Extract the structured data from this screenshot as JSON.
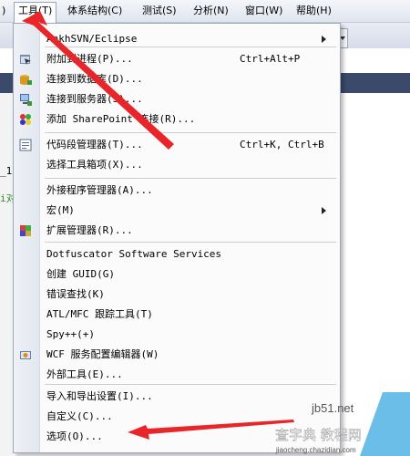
{
  "menubar": {
    "edge_label": ")",
    "items": [
      {
        "name": "menu-tools",
        "label": "工具(T)"
      },
      {
        "name": "menu-architecture",
        "label": "体系结构(C)"
      },
      {
        "name": "menu-test",
        "label": "测试(S)"
      },
      {
        "name": "menu-analyze",
        "label": "分析(N)"
      },
      {
        "name": "menu-window",
        "label": "窗口(W)"
      },
      {
        "name": "menu-help",
        "label": "帮助(H)"
      }
    ]
  },
  "background": {
    "fragment_underscore": "_1",
    "fragment_green": "i对"
  },
  "tools_menu": {
    "items": [
      {
        "label": "AnkhSVN/Eclipse",
        "shortcut": "",
        "submenu": true,
        "icon": ""
      },
      {
        "label": "附加到进程(P)...",
        "shortcut": "Ctrl+Alt+P",
        "submenu": false,
        "icon": "attach-process-icon"
      },
      {
        "label": "连接到数据库(D)...",
        "shortcut": "",
        "submenu": false,
        "icon": "connect-database-icon"
      },
      {
        "label": "连接到服务器(S)...",
        "shortcut": "",
        "submenu": false,
        "icon": "connect-server-icon"
      },
      {
        "label": "添加 SharePoint 连接(R)...",
        "shortcut": "",
        "submenu": false,
        "icon": "sharepoint-icon"
      },
      {
        "label": "代码段管理器(T)...",
        "shortcut": "Ctrl+K, Ctrl+B",
        "submenu": false,
        "icon": "code-snippets-icon"
      },
      {
        "label": "选择工具箱项(X)...",
        "shortcut": "",
        "submenu": false,
        "icon": ""
      },
      {
        "label": "外接程序管理器(A)...",
        "shortcut": "",
        "submenu": false,
        "icon": ""
      },
      {
        "label": "宏(M)",
        "shortcut": "",
        "submenu": true,
        "icon": ""
      },
      {
        "label": "扩展管理器(R)...",
        "shortcut": "",
        "submenu": false,
        "icon": "extension-manager-icon"
      },
      {
        "label": "Dotfuscator Software Services",
        "shortcut": "",
        "submenu": false,
        "icon": ""
      },
      {
        "label": "创建 GUID(G)",
        "shortcut": "",
        "submenu": false,
        "icon": ""
      },
      {
        "label": "错误查找(K)",
        "shortcut": "",
        "submenu": false,
        "icon": ""
      },
      {
        "label": "ATL/MFC 跟踪工具(T)",
        "shortcut": "",
        "submenu": false,
        "icon": ""
      },
      {
        "label": "Spy++(+)",
        "shortcut": "",
        "submenu": false,
        "icon": ""
      },
      {
        "label": "WCF 服务配置编辑器(W)",
        "shortcut": "",
        "submenu": false,
        "icon": "wcf-config-icon"
      },
      {
        "label": "外部工具(E)...",
        "shortcut": "",
        "submenu": false,
        "icon": ""
      },
      {
        "label": "导入和导出设置(I)...",
        "shortcut": "",
        "submenu": false,
        "icon": ""
      },
      {
        "label": "自定义(C)...",
        "shortcut": "",
        "submenu": false,
        "icon": ""
      },
      {
        "label": "选项(O)...",
        "shortcut": "",
        "submenu": false,
        "icon": ""
      }
    ]
  },
  "colors": {
    "annotation_arrow": "#e8262a",
    "menu_border": "#9ea8b8",
    "menu_background": "#fbfbfb"
  },
  "watermark": {
    "site_main": "查字典 教程网",
    "site_top": "jb51.net",
    "site_url": "jiaocheng.chazidian.com"
  }
}
